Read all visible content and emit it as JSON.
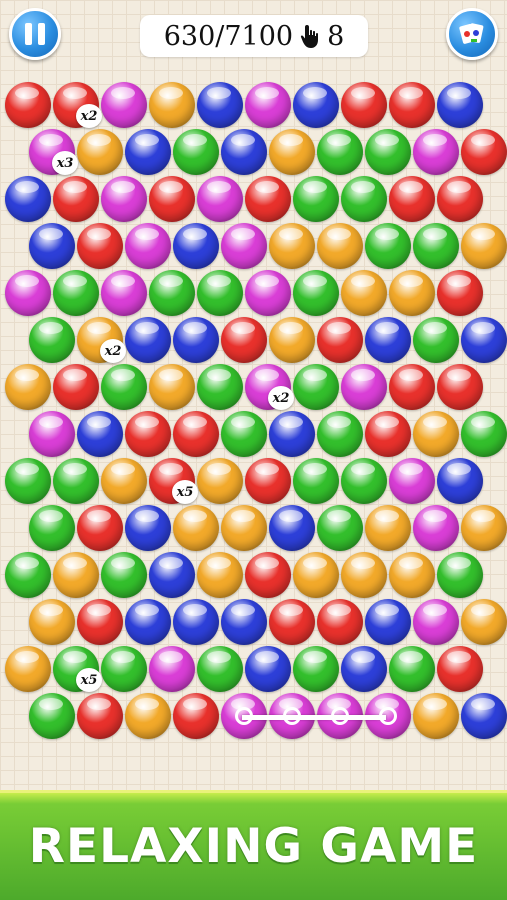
{
  "hud": {
    "score": "630/7100",
    "moves": "8",
    "pause_icon": "pause-icon",
    "hand_icon": "tap-hand-icon",
    "cards_icon": "cards-icon"
  },
  "colors": {
    "R": "#e8312c",
    "M": "#d93ed6",
    "Y": "#f2a92a",
    "B": "#2d3fd8",
    "G": "#33bf2c"
  },
  "board": {
    "rows": [
      "RRMYBMBRRB",
      "MYBGBYGGMR",
      "BRMRMRGGRR",
      "BRMBMYYGGY",
      "MGMGGMGYYR",
      "GYBBRYRBGB",
      "YRGYGMGMRR",
      "MBRRGBGRYG",
      "GGYRYRGGMB",
      "GRBYYBGYMY",
      "GYGBYRYYYG",
      "YRBBBRRBMY",
      "YGGMGBGBGR",
      "GRYRMMMMYB"
    ],
    "multipliers": [
      {
        "row": 0,
        "col": 1,
        "label": "x2"
      },
      {
        "row": 1,
        "col": 0,
        "label": "x3"
      },
      {
        "row": 5,
        "col": 1,
        "label": "x2"
      },
      {
        "row": 6,
        "col": 5,
        "label": "x2"
      },
      {
        "row": 8,
        "col": 3,
        "label": "x5"
      },
      {
        "row": 12,
        "col": 1,
        "label": "x5"
      }
    ],
    "selected_chain": {
      "row": 13,
      "cols": [
        4,
        5,
        6,
        7
      ]
    }
  },
  "banner": {
    "text": "RELAXING GAME"
  }
}
